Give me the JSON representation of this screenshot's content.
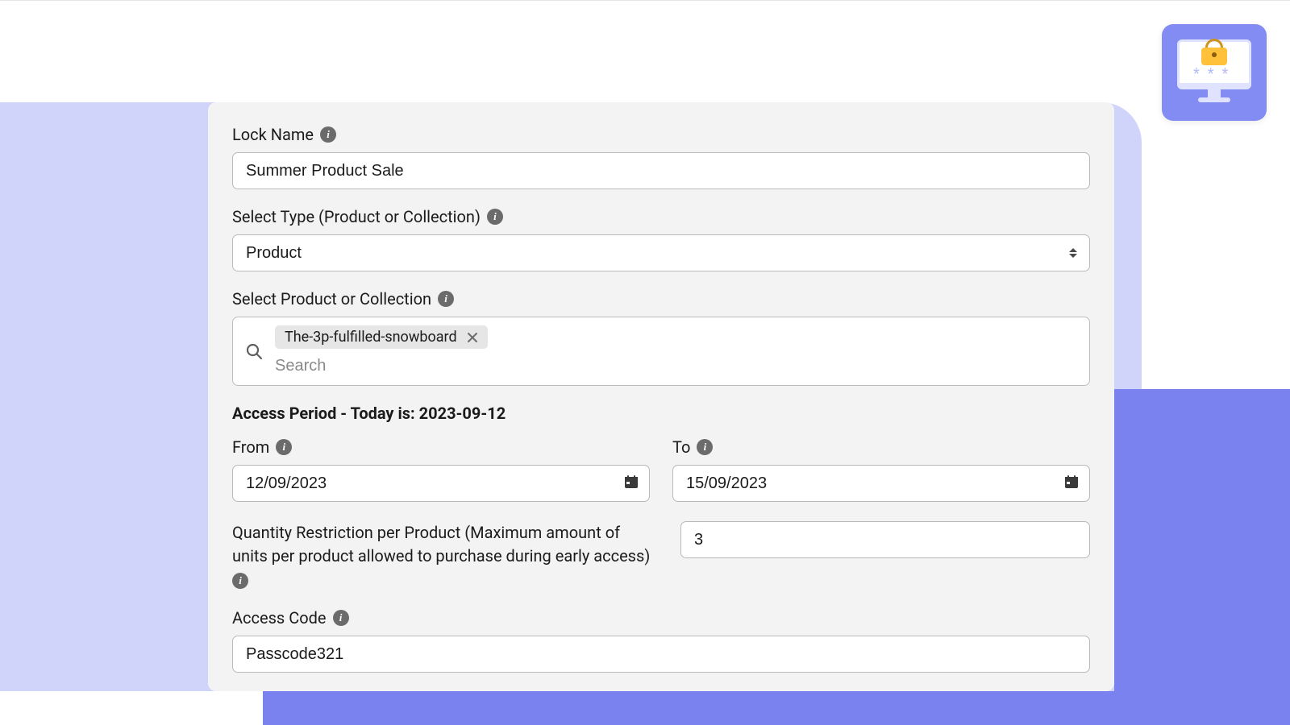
{
  "form": {
    "lock_name": {
      "label": "Lock Name",
      "value": "Summer Product Sale"
    },
    "select_type": {
      "label": "Select Type (Product or Collection)",
      "value": "Product"
    },
    "select_item": {
      "label": "Select Product or Collection",
      "chip": "The-3p-fulfilled-snowboard",
      "search_placeholder": "Search"
    },
    "access_period": {
      "heading": "Access Period - Today is: 2023-09-12",
      "from": {
        "label": "From",
        "value": "12/09/2023"
      },
      "to": {
        "label": "To",
        "value": "15/09/2023"
      }
    },
    "quantity": {
      "label": "Quantity Restriction per Product (Maximum amount of units per product allowed to purchase during early access)",
      "value": "3"
    },
    "access_code": {
      "label": "Access Code",
      "value": "Passcode321"
    }
  }
}
